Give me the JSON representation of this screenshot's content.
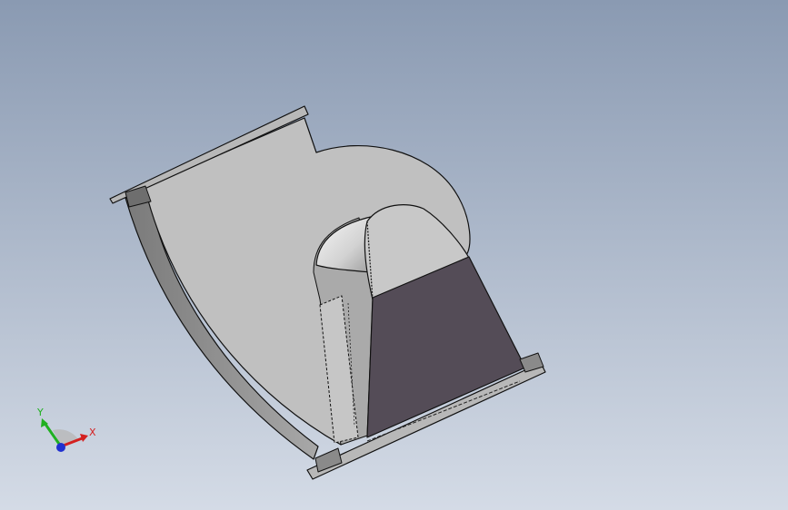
{
  "viewport": {
    "background_top": "#8a9ab2",
    "background_bottom": "#d4dbe6"
  },
  "model": {
    "shape": "centrifugal-fan-housing",
    "colors": {
      "face_light": "#c0c0c0",
      "face_side": "#8e8e8e",
      "face_dark": "#544c57",
      "edge": "#111111",
      "highlight": "#f4f4f4"
    }
  },
  "triad": {
    "x_label": "X",
    "y_label": "Y",
    "x_color": "#d42020",
    "y_color": "#20b020",
    "z_color": "#2030d0"
  }
}
